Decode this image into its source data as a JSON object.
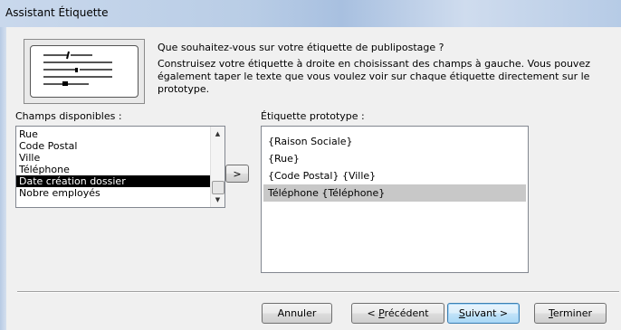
{
  "window": {
    "title": "Assistant Étiquette"
  },
  "intro": {
    "question": "Que souhaitez-vous sur votre étiquette de publipostage ?",
    "instructions": "Construisez votre étiquette à droite en choisissant des champs à gauche. Vous pouvez également taper le texte que vous voulez voir sur chaque étiquette directement sur le prototype."
  },
  "available_fields": {
    "label": "Champs disponibles :",
    "items": [
      "Rue",
      "Code Postal",
      "Ville",
      "Téléphone",
      "Date création dossier",
      "Nobre employés"
    ],
    "selected": "Date création dossier"
  },
  "add_button": {
    "label": ">"
  },
  "prototype": {
    "label": "Étiquette prototype :",
    "lines": [
      "{Raison Sociale}",
      "{Rue}",
      "{Code Postal} {Ville}",
      "Téléphone {Téléphone}"
    ],
    "selected_line": "Téléphone {Téléphone}"
  },
  "buttons": {
    "cancel": "Annuler",
    "previous_prefix": "< ",
    "previous_mnemonic": "P",
    "previous_rest": "récédent",
    "next_mnemonic": "S",
    "next_rest": "uivant >",
    "finish_mnemonic": "T",
    "finish_rest": "erminer"
  },
  "colors": {
    "selection_listbox": "#000000",
    "selection_prototype": "#c8c8c8",
    "default_button_border": "#3c7fb1"
  },
  "icons": {
    "label_illustration": "mailing-label-icon",
    "scroll_up": "scroll-up-icon",
    "scroll_down": "scroll-down-icon"
  }
}
